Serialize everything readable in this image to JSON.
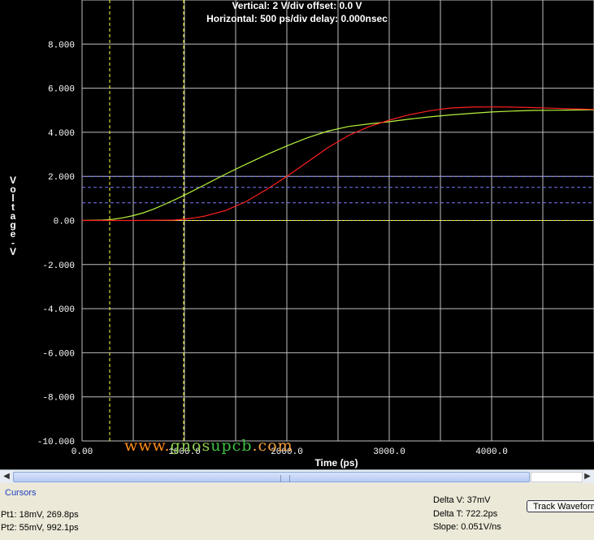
{
  "header": {
    "vertical": "Vertical: 2  V/div  offset: 0.0 V",
    "horizontal": "Horizontal: 500 ps/div  delay: 0.000nsec"
  },
  "chart_data": {
    "type": "line",
    "xlabel": "Time  (ps)",
    "ylabel": "Voltage - V",
    "xlim": [
      0,
      5000
    ],
    "ylim": [
      -10,
      10
    ],
    "x_ticks": [
      "0.00",
      "1000.0",
      "2000.0",
      "3000.0",
      "4000.0"
    ],
    "y_ticks": [
      "8.000",
      "6.000",
      "4.000",
      "2.000",
      "0.00",
      "-2.000",
      "-4.000",
      "-6.000",
      "-8.000",
      "-10.000"
    ],
    "grid": true,
    "series": [
      {
        "color": "#b6f23c",
        "x": [
          0,
          200,
          300,
          400,
          500,
          600,
          700,
          800,
          900,
          1000,
          1200,
          1400,
          1600,
          1800,
          2000,
          2200,
          2400,
          2600,
          2800,
          3000,
          3200,
          3400,
          3600,
          3800,
          4000,
          4200,
          4400,
          4600,
          4800,
          5000
        ],
        "y": [
          0.0,
          0.02,
          0.05,
          0.12,
          0.22,
          0.35,
          0.52,
          0.72,
          0.93,
          1.15,
          1.62,
          2.1,
          2.55,
          2.98,
          3.38,
          3.75,
          4.05,
          4.26,
          4.38,
          4.48,
          4.6,
          4.7,
          4.79,
          4.86,
          4.92,
          4.96,
          4.99,
          5.0,
          5.01,
          5.02
        ]
      },
      {
        "color": "#ff2020",
        "x": [
          0,
          500,
          900,
          1000,
          1100,
          1200,
          1400,
          1600,
          1800,
          2000,
          2200,
          2400,
          2600,
          2800,
          3000,
          3200,
          3400,
          3600,
          3800,
          4000,
          4200,
          4400,
          4600,
          4800,
          5000
        ],
        "y": [
          0.0,
          0.0,
          0.02,
          0.06,
          0.12,
          0.2,
          0.45,
          0.85,
          1.4,
          2.0,
          2.65,
          3.3,
          3.85,
          4.25,
          4.55,
          4.8,
          4.98,
          5.1,
          5.14,
          5.15,
          5.14,
          5.12,
          5.09,
          5.06,
          5.04
        ]
      }
    ],
    "reference_levels": [
      2.0,
      1.5,
      0.8
    ],
    "cursor_times": [
      269.8,
      992.1
    ],
    "watermark": "www.gnosupcb.com"
  },
  "cursors": {
    "title": "Cursors",
    "pt1": "Pt1: 18mV, 269.8ps",
    "pt2": "Pt2: 55mV, 992.1ps",
    "delta_v": "Delta V: 37mV",
    "delta_t": "Delta T: 722.2ps",
    "slope": "Slope: 0.051V/ns",
    "track_button": "Track Waveform"
  },
  "colors": {
    "grid": "#c0c0c0",
    "cursor": "#ffff33",
    "reference": "#7b7bff",
    "panel_bg": "#ece9d8",
    "accent": "#1f3fbf"
  }
}
